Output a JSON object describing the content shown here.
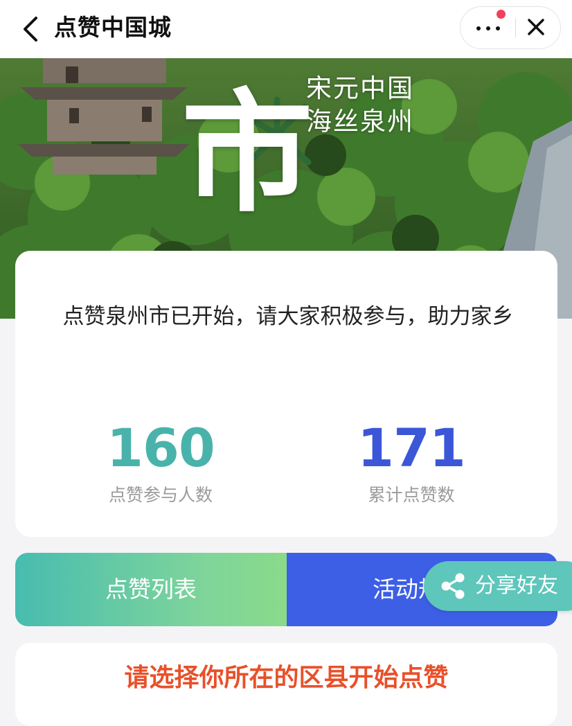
{
  "nav": {
    "title": "点赞中国城",
    "more_icon": "more-dots-icon",
    "close_icon": "close-icon",
    "back_icon": "chevron-left-icon",
    "notification_dot_color": "#f0405a"
  },
  "hero": {
    "big_character": "市",
    "tagline_line1": "宋元中国",
    "tagline_line2": "海丝泉州"
  },
  "stats_card": {
    "intro": "点赞泉州市已开始，请大家积极参与，助力家乡",
    "participants": {
      "value": "160",
      "label": "点赞参与人数",
      "color": "#49b3ab"
    },
    "total_likes": {
      "value": "171",
      "label": "累计点赞数",
      "color": "#3b57d8"
    }
  },
  "actions": {
    "like_list_label": "点赞列表",
    "rules_label": "活动规",
    "share_label": "分享好友",
    "share_icon": "share-icon"
  },
  "bottom": {
    "prompt": "请选择你所在的区县开始点赞",
    "prompt_color": "#e8502a"
  }
}
